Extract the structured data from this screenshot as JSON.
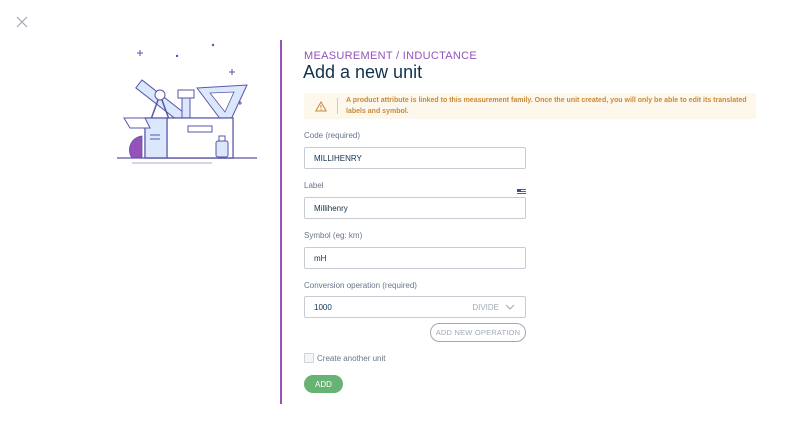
{
  "header": {
    "breadcrumb": "MEASUREMENT / INDUCTANCE",
    "title": "Add a new unit"
  },
  "icons": {
    "close": "close-icon",
    "warning": "warning-icon",
    "flag": "us-flag-icon",
    "chevron": "chevron-down-icon",
    "illustration": "toolbox-illustration"
  },
  "warning": {
    "text": "A product attribute is linked to this measurement family. Once the unit created, you will only be able to edit its translated labels and symbol."
  },
  "form": {
    "code": {
      "label": "Code (required)",
      "value": "MILLIHENRY"
    },
    "label": {
      "label": "Label",
      "value": "Millihenry",
      "locale": "en_US"
    },
    "symbol": {
      "label": "Symbol (eg: km)",
      "value": "mH"
    },
    "conversion": {
      "label": "Conversion operation (required)",
      "value": "1000",
      "operator": "DIVIDE"
    },
    "add_operation_label": "ADD NEW OPERATION",
    "create_another_label": "Create another unit",
    "create_another_checked": false,
    "submit_label": "ADD"
  },
  "colors": {
    "accent": "#9452ba",
    "warning_bg": "#fef7ec",
    "warning_text": "#c88a38",
    "success": "#67b373"
  }
}
